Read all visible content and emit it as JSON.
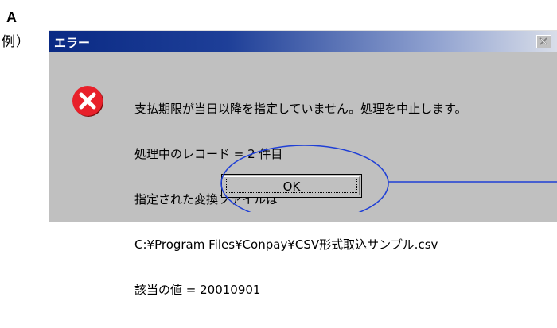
{
  "annotation": {
    "label_a": "A",
    "label_example": "例）"
  },
  "dialog": {
    "title": "エラー",
    "message_lines": [
      "支払期限が当日以降を指定していません。処理を中止します。",
      "処理中のレコード = 2 件目",
      "指定された変換ファイルは",
      "C:¥Program Files¥Conpay¥CSV形式取込サンプル.csv",
      "該当の値 = 20010901"
    ],
    "ok_label": "OK",
    "icon": "error-icon"
  },
  "colors": {
    "titlebar_start": "#0a2a84",
    "titlebar_end": "#d9dee9",
    "dialog_bg": "#c0c0c0",
    "error_red": "#e8202a",
    "annotation_blue": "#1f3fd6"
  }
}
